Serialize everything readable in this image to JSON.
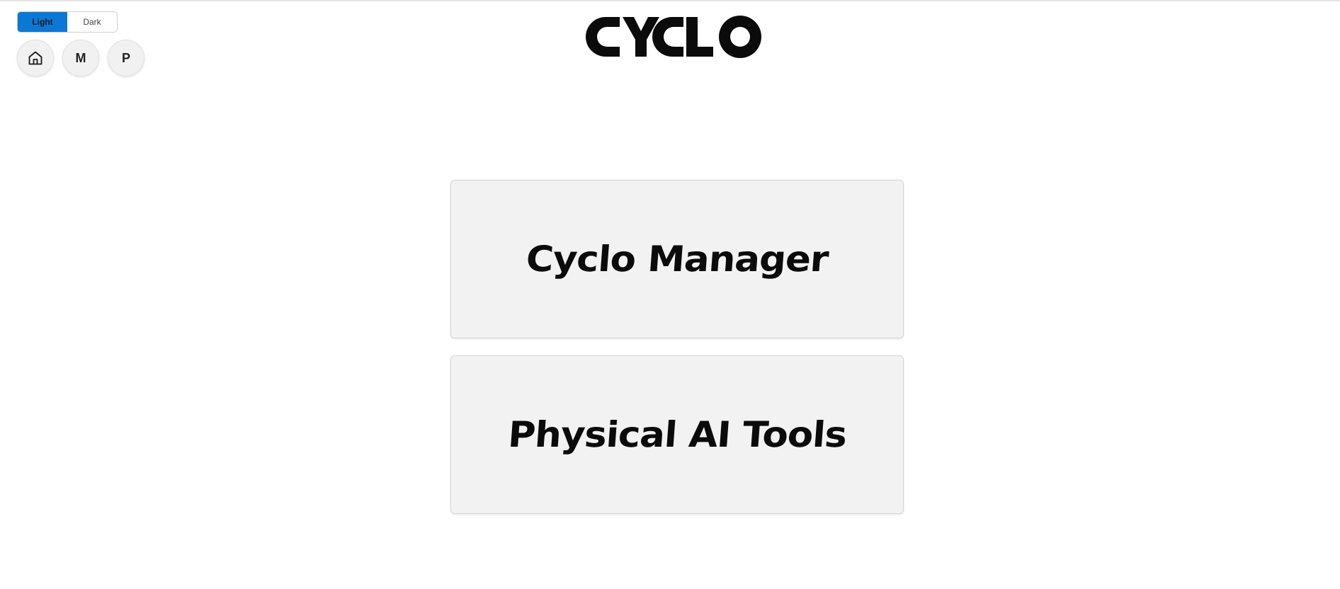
{
  "theme_toggle": {
    "light_label": "Light",
    "dark_label": "Dark",
    "selected": "Light",
    "accent_color": "#0a78d4"
  },
  "nav": {
    "home_icon": "home-icon",
    "m_label": "M",
    "p_label": "P"
  },
  "logo": {
    "text": "CYCLO"
  },
  "cards": [
    {
      "label": "Cyclo Manager"
    },
    {
      "label": "Physical AI Tools"
    }
  ]
}
